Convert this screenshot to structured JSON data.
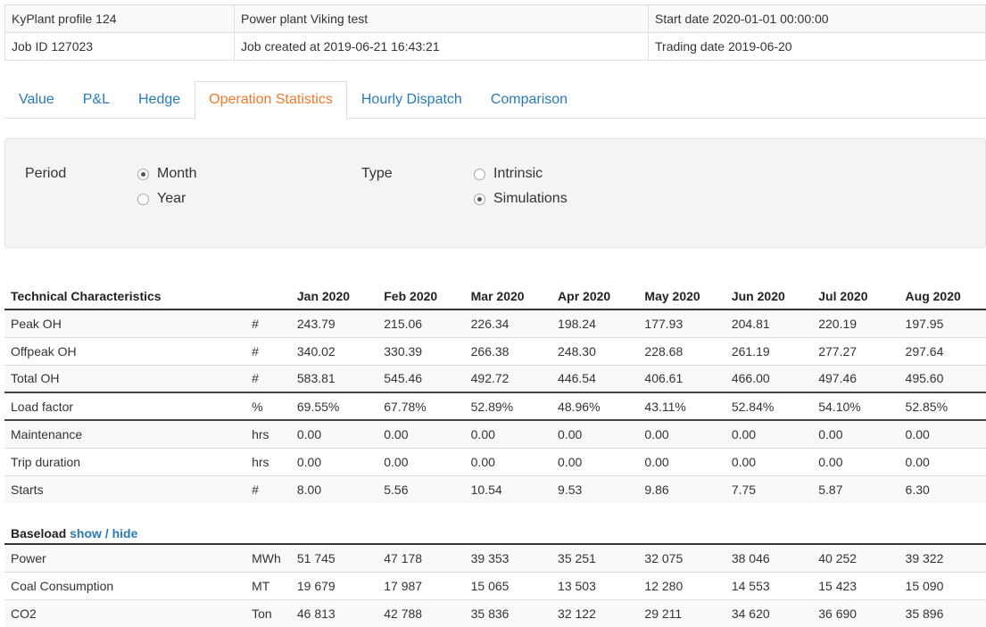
{
  "header": {
    "profile": "KyPlant profile 124",
    "plant": "Power plant Viking test",
    "start_date": "Start date 2020-01-01 00:00:00",
    "job_id": "Job ID 127023",
    "job_created": "Job created at 2019-06-21 16:43:21",
    "trading_date": "Trading date 2019-06-20"
  },
  "tabs": [
    {
      "label": "Value",
      "active": false
    },
    {
      "label": "P&L",
      "active": false
    },
    {
      "label": "Hedge",
      "active": false
    },
    {
      "label": "Operation Statistics",
      "active": true
    },
    {
      "label": "Hourly Dispatch",
      "active": false
    },
    {
      "label": "Comparison",
      "active": false
    }
  ],
  "filters": {
    "period_label": "Period",
    "period_options": [
      {
        "label": "Month",
        "checked": true
      },
      {
        "label": "Year",
        "checked": false
      }
    ],
    "type_label": "Type",
    "type_options": [
      {
        "label": "Intrinsic",
        "checked": false
      },
      {
        "label": "Simulations",
        "checked": true
      }
    ]
  },
  "table": {
    "title": "Technical Characteristics",
    "months": [
      "Jan 2020",
      "Feb 2020",
      "Mar 2020",
      "Apr 2020",
      "May 2020",
      "Jun 2020",
      "Jul 2020",
      "Aug 2020"
    ],
    "technical_rows": [
      {
        "name": "Peak OH",
        "unit": "#",
        "values": [
          "243.79",
          "215.06",
          "226.34",
          "198.24",
          "177.93",
          "204.81",
          "220.19",
          "197.95"
        ]
      },
      {
        "name": "Offpeak OH",
        "unit": "#",
        "values": [
          "340.02",
          "330.39",
          "266.38",
          "248.30",
          "228.68",
          "261.19",
          "277.27",
          "297.64"
        ]
      },
      {
        "name": "Total OH",
        "unit": "#",
        "values": [
          "583.81",
          "545.46",
          "492.72",
          "446.54",
          "406.61",
          "466.00",
          "497.46",
          "495.60"
        ]
      },
      {
        "name": "Load factor",
        "unit": "%",
        "values": [
          "69.55%",
          "67.78%",
          "52.89%",
          "48.96%",
          "43.11%",
          "52.84%",
          "54.10%",
          "52.85%"
        ]
      },
      {
        "name": "Maintenance",
        "unit": "hrs",
        "values": [
          "0.00",
          "0.00",
          "0.00",
          "0.00",
          "0.00",
          "0.00",
          "0.00",
          "0.00"
        ]
      },
      {
        "name": "Trip duration",
        "unit": "hrs",
        "values": [
          "0.00",
          "0.00",
          "0.00",
          "0.00",
          "0.00",
          "0.00",
          "0.00",
          "0.00"
        ]
      },
      {
        "name": "Starts",
        "unit": "#",
        "values": [
          "8.00",
          "5.56",
          "10.54",
          "9.53",
          "9.86",
          "7.75",
          "5.87",
          "6.30"
        ]
      }
    ],
    "baseload_title": "Baseload",
    "baseload_toggle": "show / hide",
    "baseload_rows": [
      {
        "name": "Power",
        "unit": "MWh",
        "values": [
          "51 745",
          "47 178",
          "39 353",
          "35 251",
          "32 075",
          "38 046",
          "40 252",
          "39 322"
        ]
      },
      {
        "name": "Coal Consumption",
        "unit": "MT",
        "values": [
          "19 679",
          "17 987",
          "15 065",
          "13 503",
          "12 280",
          "14 553",
          "15 423",
          "15 090"
        ]
      },
      {
        "name": "CO2",
        "unit": "Ton",
        "values": [
          "46 813",
          "42 788",
          "35 836",
          "32 122",
          "29 211",
          "34 620",
          "36 690",
          "35 896"
        ]
      }
    ]
  }
}
